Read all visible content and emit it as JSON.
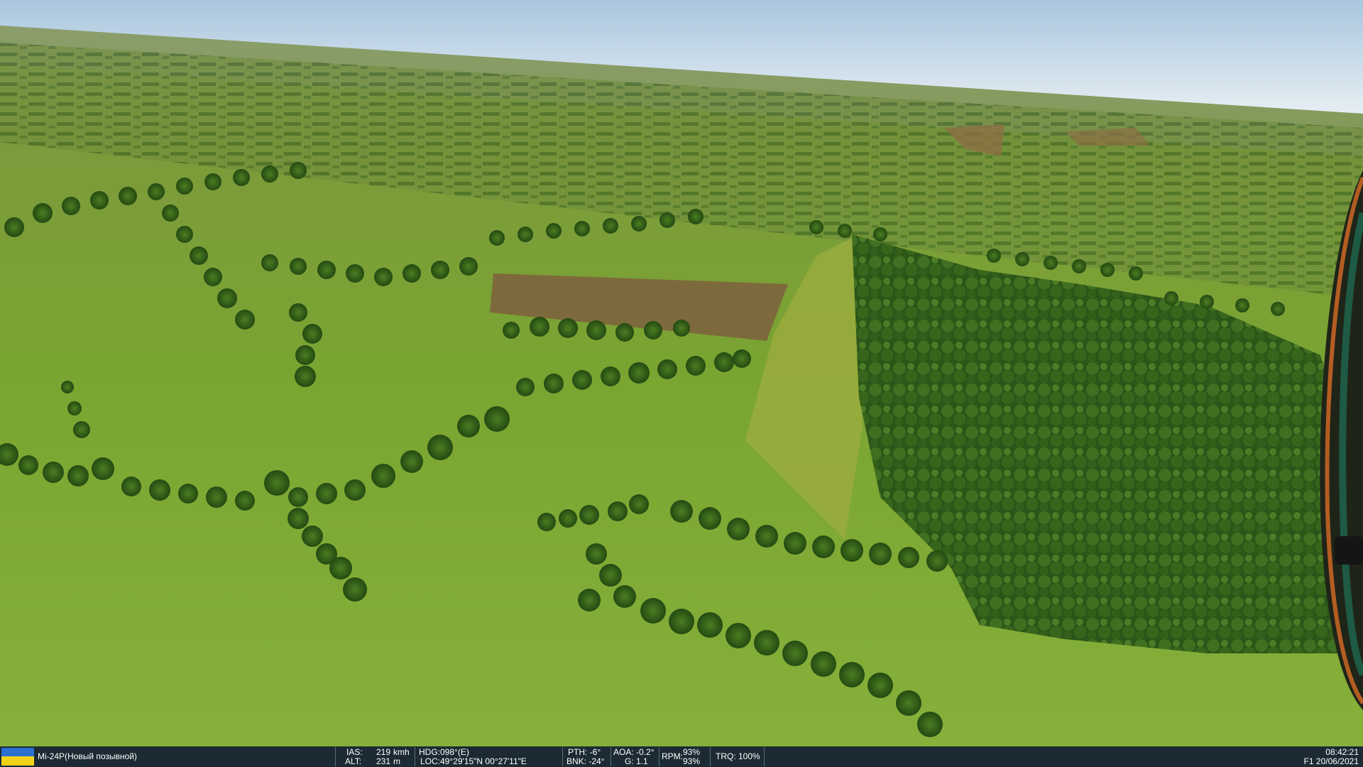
{
  "hud": {
    "aircraft": "Mi-24P(Новый позывной)",
    "ias_label": "IAS:",
    "ias_value": "219",
    "ias_unit": "kmh",
    "alt_label": "ALT:",
    "alt_value": "231",
    "alt_unit": "m",
    "hdg": "HDG:098°(E)",
    "loc": "LOC:49°29'15\"N 00°27'11\"E",
    "pth": "PTH: -6°",
    "bnk": "BNK: -24°",
    "aoa": "AOA: -0.2°",
    "g": "G: 1.1",
    "rpm_label": "RPM:",
    "rpm1": "93%",
    "rpm2": "93%",
    "trq": "TRQ: 100%",
    "time": "08:42:21",
    "date": "F1 20/06/2021"
  },
  "colors": {
    "sky": "#c9dceb",
    "grass": "#7fa734",
    "forest": "#2f5a1a",
    "hud_bg": "#1b2a33",
    "flag_blue": "#2b6fd1",
    "flag_yellow": "#f2d31a"
  }
}
